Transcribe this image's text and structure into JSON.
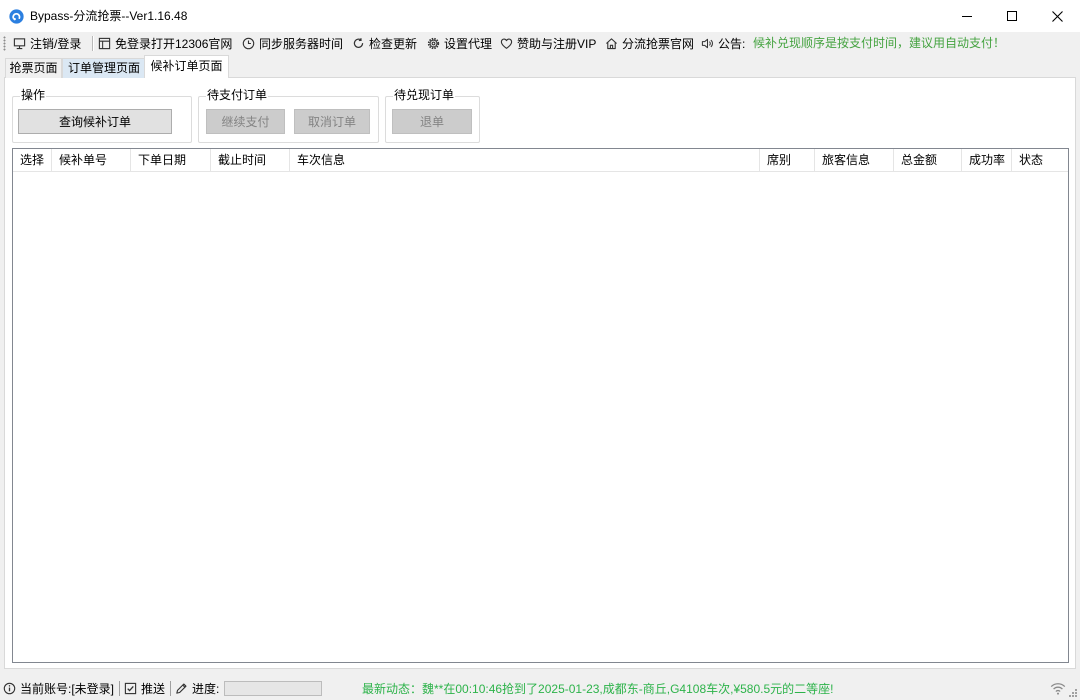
{
  "window": {
    "title": "Bypass-分流抢票--Ver1.16.48",
    "app_icon": "app-logo-icon",
    "controls": [
      "minimize-icon",
      "maximize-icon",
      "close-icon"
    ]
  },
  "toolbar": {
    "items": [
      {
        "label": "注销/登录",
        "icon": "monitor-icon"
      },
      {
        "label": "免登录打开12306官网",
        "icon": "browser-window-icon"
      },
      {
        "label": "同步服务器时间",
        "icon": "clock-icon"
      },
      {
        "label": "检查更新",
        "icon": "refresh-icon"
      },
      {
        "label": "设置代理",
        "icon": "gear-icon"
      },
      {
        "label": "赞助与注册VIP",
        "icon": "heart-icon"
      },
      {
        "label": "分流抢票官网",
        "icon": "home-icon"
      }
    ],
    "notice": {
      "icon": "speaker-icon",
      "label": "公告:",
      "text": "候补兑现顺序是按支付时间，建议用自动支付！",
      "color": "#45a340"
    }
  },
  "tabs": [
    {
      "label": "抢票页面",
      "selected": false
    },
    {
      "label": "订单管理页面",
      "selected": false
    },
    {
      "label": "候补订单页面",
      "selected": true
    }
  ],
  "groups": {
    "operation": {
      "title": "操作",
      "buttons": [
        {
          "label": "查询候补订单",
          "enabled": true
        }
      ]
    },
    "pending_payment": {
      "title": "待支付订单",
      "buttons": [
        {
          "label": "继续支付",
          "enabled": false
        },
        {
          "label": "取消订单",
          "enabled": false
        }
      ]
    },
    "pending_fulfillment": {
      "title": "待兑现订单",
      "buttons": [
        {
          "label": "退单",
          "enabled": false
        }
      ]
    }
  },
  "table": {
    "columns": [
      "选择",
      "候补单号",
      "下单日期",
      "截止时间",
      "车次信息",
      "席别",
      "旅客信息",
      "总金额",
      "成功率",
      "状态"
    ],
    "rows": []
  },
  "statusbar": {
    "account": {
      "icon": "info-icon",
      "text": "当前账号:[未登录]"
    },
    "push": {
      "icon": "checkbox-icon",
      "text": "推送"
    },
    "progress": {
      "icon": "pen-icon",
      "label": "进度:",
      "value": 0
    },
    "news": {
      "text": "最新动态：魏**在00:10:46抢到了2025-01-23,成都东-商丘,G4108车次,¥580.5元的二等座!",
      "color": "#2db34a"
    },
    "network_icon": "wifi-icon"
  }
}
